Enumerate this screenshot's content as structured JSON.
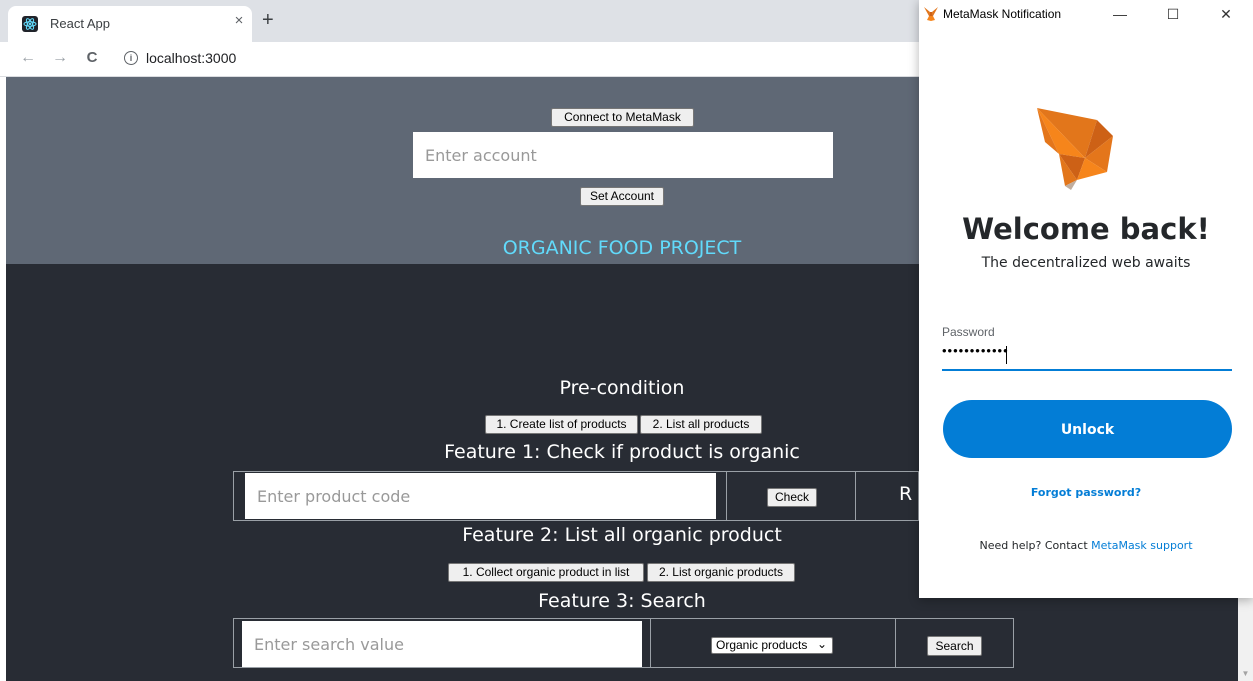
{
  "browser": {
    "tab_title": "React App",
    "close_glyph": "×",
    "new_tab_glyph": "+",
    "back_glyph": "←",
    "forward_glyph": "→",
    "reload_glyph": "C",
    "info_glyph": "i",
    "url": "localhost:3000"
  },
  "header": {
    "connect_label": "Connect to MetaMask",
    "account_placeholder": "Enter account",
    "set_account_label": "Set Account",
    "project_title": "ORGANIC FOOD PROJECT"
  },
  "precondition": {
    "heading": "Pre-condition",
    "create_label": "1. Create list of products",
    "list_all_label": "2. List all products"
  },
  "feature1": {
    "heading": "Feature 1: Check if product is organic",
    "input_placeholder": "Enter product code",
    "check_label": "Check",
    "result_partial": "R"
  },
  "feature2": {
    "heading": "Feature 2: List all organic product",
    "collect_label": "1. Collect organic product in list",
    "list_label": "2. List organic products"
  },
  "feature3": {
    "heading": "Feature 3: Search",
    "input_placeholder": "Enter search value",
    "select_value": "Organic products",
    "search_label": "Search"
  },
  "metamask": {
    "window_title": "MetaMask Notification",
    "minimize_glyph": "—",
    "maximize_glyph": "☐",
    "close_glyph": "✕",
    "welcome": "Welcome back!",
    "subtitle": "The decentralized web awaits",
    "password_label": "Password",
    "password_value": "••••••••••••",
    "unlock_label": "Unlock",
    "forgot_label": "Forgot password?",
    "help_prefix": "Need help? Contact ",
    "help_link": "MetaMask support",
    "fox_colors": [
      "#e2761b",
      "#f6851b",
      "#cd6116",
      "#c0ad9e"
    ]
  },
  "colors": {
    "page_bg": "#282c34",
    "header_bg": "#5f6875",
    "title_accent": "#61dafb",
    "metamask_blue": "#037dd6"
  }
}
